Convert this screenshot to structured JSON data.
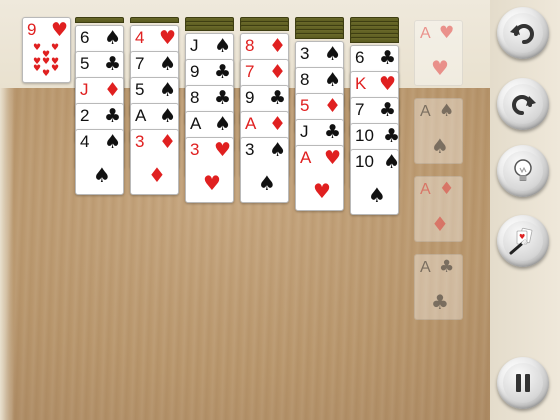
{
  "colors": {
    "red": "#e02020",
    "black": "#111111",
    "card_back": "#5a5a1e"
  },
  "waste": {
    "rank": "9",
    "suit": "♥",
    "color": "red"
  },
  "columns": [
    {
      "facedown": 1,
      "cards": [
        {
          "rank": "6",
          "suit": "♠",
          "color": "black"
        },
        {
          "rank": "5",
          "suit": "♣",
          "color": "black"
        },
        {
          "rank": "J",
          "suit": "♦",
          "color": "red"
        },
        {
          "rank": "2",
          "suit": "♣",
          "color": "black"
        },
        {
          "rank": "4",
          "suit": "♠",
          "color": "black"
        }
      ]
    },
    {
      "facedown": 1,
      "cards": [
        {
          "rank": "4",
          "suit": "♥",
          "color": "red"
        },
        {
          "rank": "7",
          "suit": "♠",
          "color": "black"
        },
        {
          "rank": "5",
          "suit": "♠",
          "color": "black"
        },
        {
          "rank": "A",
          "suit": "♠",
          "color": "black"
        },
        {
          "rank": "3",
          "suit": "♦",
          "color": "red"
        }
      ]
    },
    {
      "facedown": 3,
      "cards": [
        {
          "rank": "J",
          "suit": "♠",
          "color": "black"
        },
        {
          "rank": "9",
          "suit": "♣",
          "color": "black"
        },
        {
          "rank": "8",
          "suit": "♣",
          "color": "black"
        },
        {
          "rank": "A",
          "suit": "♠",
          "color": "black"
        },
        {
          "rank": "3",
          "suit": "♥",
          "color": "red"
        }
      ]
    },
    {
      "facedown": 3,
      "cards": [
        {
          "rank": "8",
          "suit": "♦",
          "color": "red"
        },
        {
          "rank": "7",
          "suit": "♦",
          "color": "red"
        },
        {
          "rank": "9",
          "suit": "♣",
          "color": "black"
        },
        {
          "rank": "A",
          "suit": "♦",
          "color": "red"
        },
        {
          "rank": "3",
          "suit": "♠",
          "color": "black"
        }
      ]
    },
    {
      "facedown": 5,
      "cards": [
        {
          "rank": "3",
          "suit": "♠",
          "color": "black"
        },
        {
          "rank": "8",
          "suit": "♠",
          "color": "black"
        },
        {
          "rank": "5",
          "suit": "♦",
          "color": "red"
        },
        {
          "rank": "J",
          "suit": "♣",
          "color": "black"
        },
        {
          "rank": "A",
          "suit": "♥",
          "color": "red"
        }
      ]
    },
    {
      "facedown": 6,
      "cards": [
        {
          "rank": "6",
          "suit": "♣",
          "color": "black"
        },
        {
          "rank": "K",
          "suit": "♥",
          "color": "red"
        },
        {
          "rank": "7",
          "suit": "♣",
          "color": "black"
        },
        {
          "rank": "10",
          "suit": "♣",
          "color": "black"
        },
        {
          "rank": "10",
          "suit": "♠",
          "color": "black"
        }
      ]
    }
  ],
  "foundations": [
    {
      "rank": "A",
      "suit": "♥",
      "color": "red"
    },
    {
      "rank": "A",
      "suit": "♠",
      "color": "black"
    },
    {
      "rank": "A",
      "suit": "♦",
      "color": "red"
    },
    {
      "rank": "A",
      "suit": "♣",
      "color": "black"
    }
  ],
  "controls": [
    {
      "name": "undo-button",
      "icon": "undo-arrow-icon"
    },
    {
      "name": "redo-button",
      "icon": "redo-arrow-icon"
    },
    {
      "name": "hint-button",
      "icon": "lightbulb-icon"
    },
    {
      "name": "magic-wand-button",
      "icon": "magic-wand-icon"
    },
    {
      "name": "pause-button",
      "icon": "pause-icon"
    }
  ]
}
